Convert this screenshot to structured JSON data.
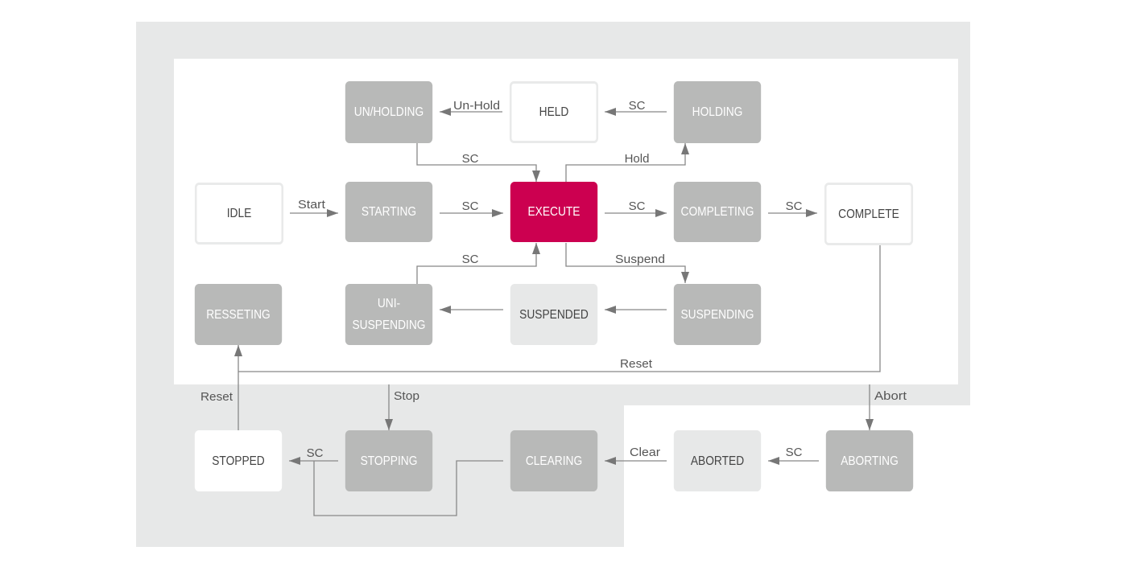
{
  "colors": {
    "outer_zone": "#e7e8e8",
    "inner_zone": "#ffffff",
    "active_state": "#cc0050",
    "acting_state": "#b8b9b8",
    "waiting_state": "#ffffff",
    "final_state": "#e7e8e8",
    "arrow": "#777777",
    "label_text": "#555555"
  },
  "states": {
    "un_holding": "UN/HOLDING",
    "held": "HELD",
    "holding": "HOLDING",
    "idle": "IDLE",
    "starting": "STARTING",
    "execute": "EXECUTE",
    "completing": "COMPLETING",
    "complete": "COMPLETE",
    "resseting": "RESSETING",
    "uni_suspending": "UNI-\nSUSPENDING",
    "suspended": "SUSPENDED",
    "suspending": "SUSPENDING",
    "stopped": "STOPPED",
    "stopping": "STOPPING",
    "clearing": "CLEARING",
    "aborted": "ABORTED",
    "aborting": "ABORTING"
  },
  "transitions": {
    "unhold": "Un-Hold",
    "held_from_holding": "SC",
    "unholding_to_execute": "SC",
    "hold": "Hold",
    "start": "Start",
    "starting_to_execute": "SC",
    "execute_to_completing": "SC",
    "completing_to_complete": "SC",
    "unisuspending_to_execute": "SC",
    "suspend": "Suspend",
    "reset_from_complete": "Reset",
    "reset_from_stopped": "Reset",
    "stop": "Stop",
    "abort": "Abort",
    "stopping_to_stopped": "SC",
    "clear": "Clear",
    "aborting_to_aborted": "SC"
  }
}
